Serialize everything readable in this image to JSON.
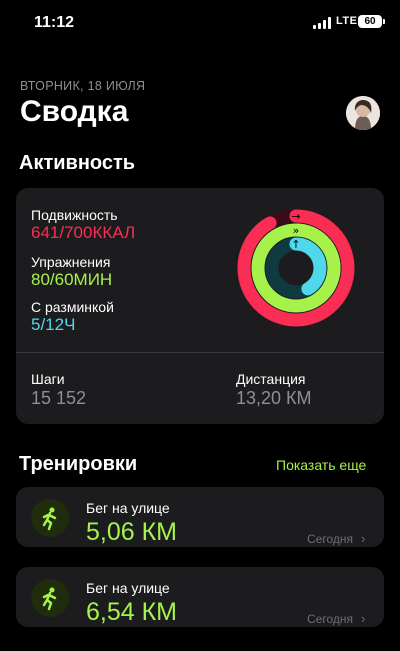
{
  "status": {
    "time": "11:12",
    "network": "LTE",
    "battery": "60"
  },
  "header": {
    "date": "ВТОРНИК, 18 ИЮЛЯ",
    "title": "Сводка",
    "avatar_icon": "profile-avatar"
  },
  "activity": {
    "title": "Активность",
    "move": {
      "label": "Подвижность",
      "value": "641/700ККАЛ",
      "progress": 0.916,
      "color": "#fa2d55"
    },
    "exercise": {
      "label": "Упражнения",
      "value": "80/60МИН",
      "progress": 1.333,
      "color": "#a6f14a"
    },
    "stand": {
      "label": "С разминкой",
      "value": "5/12Ч",
      "progress": 0.417,
      "color": "#4fd8ec"
    },
    "steps": {
      "label": "Шаги",
      "value": "15 152"
    },
    "distance": {
      "label": "Дистанция",
      "value": "13,20 КМ"
    }
  },
  "workouts": {
    "title": "Тренировки",
    "show_more": "Показать еще",
    "items": [
      {
        "name": "Бег на улице",
        "distance": "5,06 КМ",
        "date": "Сегодня",
        "icon": "running-icon"
      },
      {
        "name": "Бег на улице",
        "distance": "6,54 КМ",
        "date": "Сегодня",
        "icon": "running-icon"
      }
    ]
  }
}
